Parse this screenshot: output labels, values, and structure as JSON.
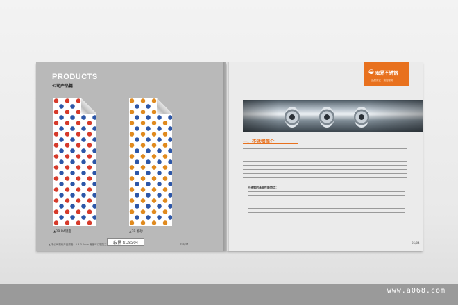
{
  "brochure": {
    "left_page": {
      "title": "PRODUCTS",
      "subtitle": "公司产品篇",
      "samples": [
        {
          "caption": "▲2B BA镜面",
          "variant": "red"
        },
        {
          "caption": "▲2B 磨砂",
          "variant": "gold"
        }
      ],
      "footer_text": "▲ 本公司现有产品规格：0.3-3.0mm 宽度可订制加工",
      "brand_badge": "宏界 SUS304",
      "page_number": "03/04"
    },
    "right_page": {
      "logo_text": "宏界不锈钢",
      "logo_slogan": "品质保证 · 诚信服务",
      "section_title": "一、不锈钢简介",
      "bullet_heading": "不锈钢的基本性能特点：",
      "page_number": "05/04"
    }
  },
  "watermark": "www.a068.com",
  "colors": {
    "accent": "#e8711e",
    "page_left": "#b9b9b9",
    "page_right": "#ebebeb",
    "footer_band": "#9a9a9a"
  }
}
